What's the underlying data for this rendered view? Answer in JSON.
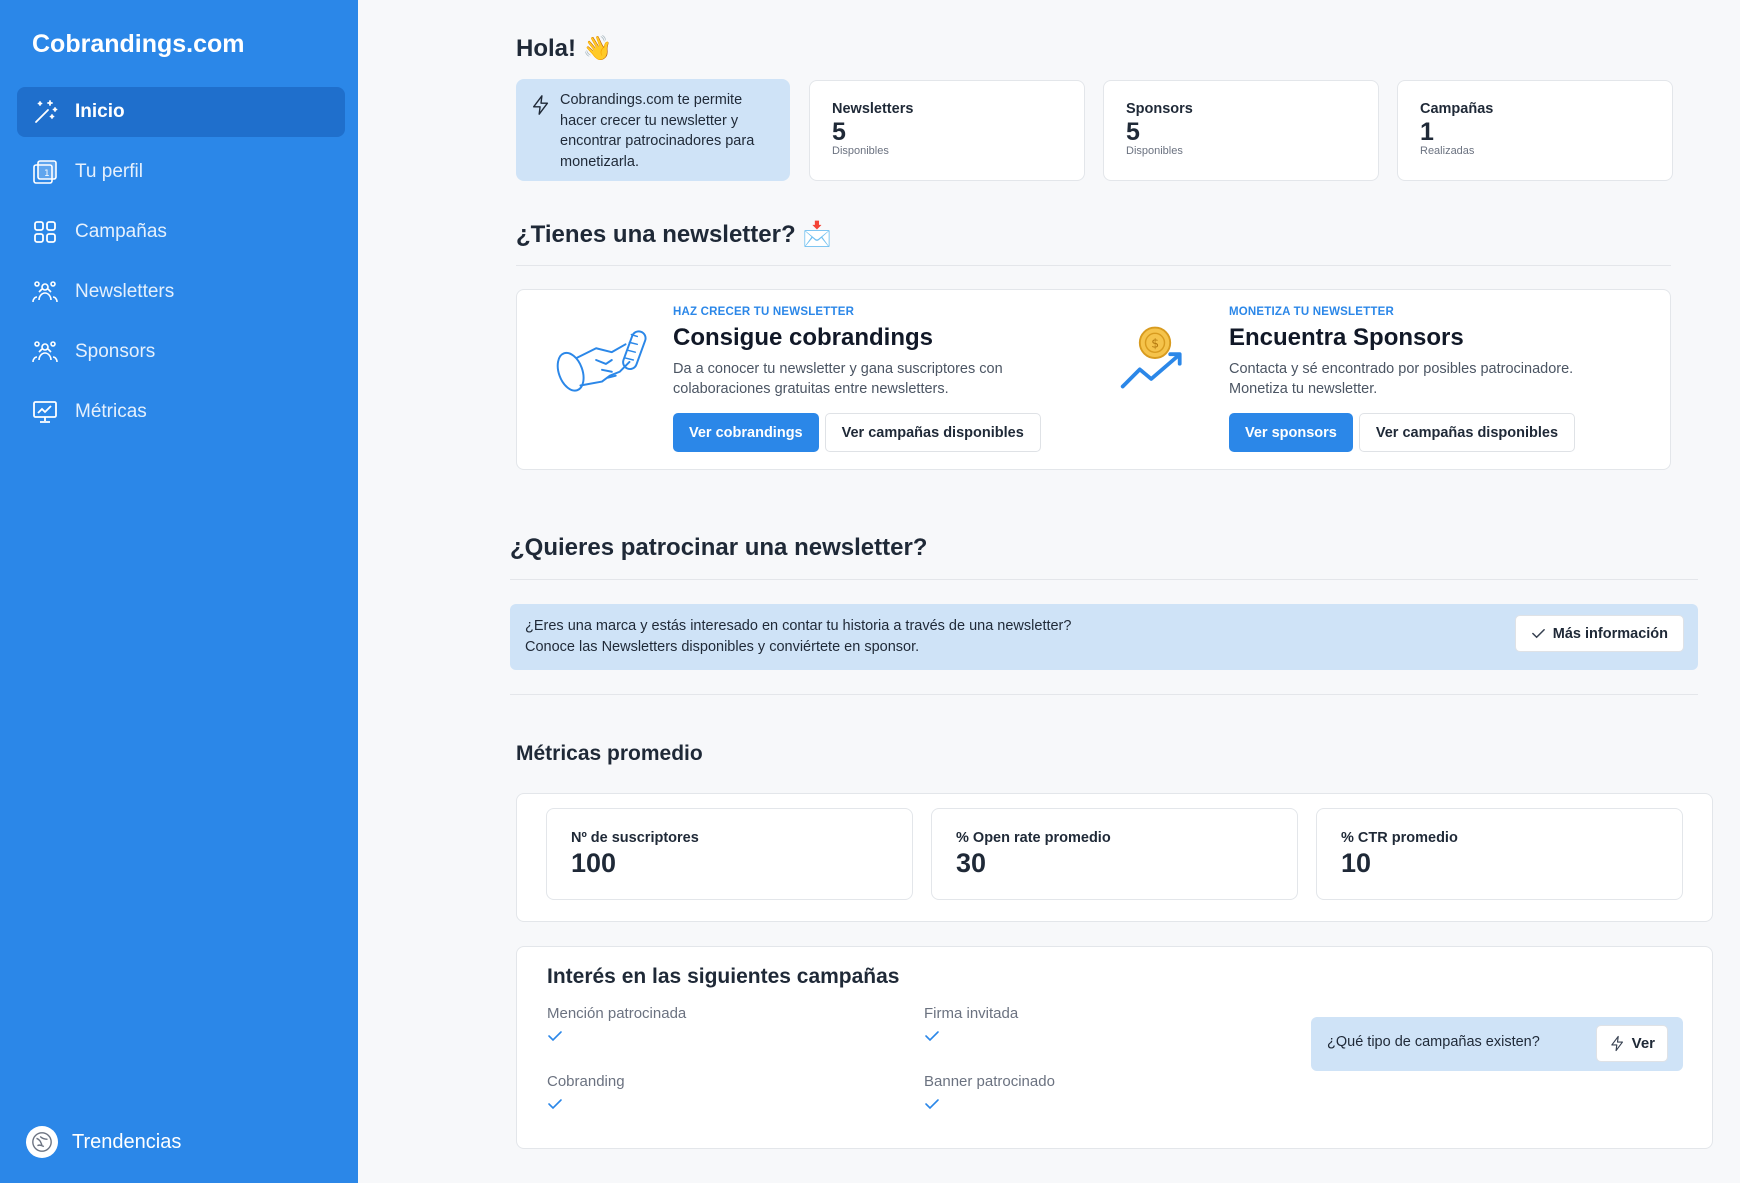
{
  "app": {
    "brand": "Cobrandings.com"
  },
  "sidebar": {
    "items": [
      {
        "label": "Inicio",
        "icon": "magic-wand-icon",
        "active": true
      },
      {
        "label": "Tu perfil",
        "icon": "profile-card-icon",
        "active": false
      },
      {
        "label": "Campañas",
        "icon": "grid-icon",
        "active": false
      },
      {
        "label": "Newsletters",
        "icon": "people-network-icon",
        "active": false
      },
      {
        "label": "Sponsors",
        "icon": "people-network-icon",
        "active": false
      },
      {
        "label": "Métricas",
        "icon": "monitor-chart-icon",
        "active": false
      }
    ],
    "footer": {
      "label": "Trendencias",
      "icon": "avatar-icon"
    }
  },
  "greeting": {
    "title": "Hola! 👋"
  },
  "intro": {
    "text": "Cobrandings.com te permite hacer crecer tu newsletter y encontrar patrocinadores para monetizarla."
  },
  "stats": [
    {
      "label": "Newsletters",
      "value": "5",
      "sub": "Disponibles"
    },
    {
      "label": "Sponsors",
      "value": "5",
      "sub": "Disponibles"
    },
    {
      "label": "Campañas",
      "value": "1",
      "sub": "Realizadas"
    }
  ],
  "newsletter_section": {
    "title": "¿Tienes una newsletter? 📩",
    "promos": [
      {
        "eyebrow": "HAZ CRECER TU NEWSLETTER",
        "title": "Consigue cobrandings",
        "desc1": "Da a conocer tu newsletter y gana suscriptores con",
        "desc2": "colaboraciones gratuitas entre newsletters.",
        "primary": "Ver cobrandings",
        "secondary": "Ver campañas disponibles"
      },
      {
        "eyebrow": "MONETIZA TU NEWSLETTER",
        "title": "Encuentra Sponsors",
        "desc1": "Contacta y sé encontrado por posibles patrocinadore.",
        "desc2": "Monetiza tu newsletter.",
        "primary": "Ver sponsors",
        "secondary": "Ver campañas disponibles"
      }
    ]
  },
  "sponsor_section": {
    "title": "¿Quieres patrocinar una newsletter?",
    "line1": "¿Eres una marca y estás interesado en contar tu historia a través de una newsletter?",
    "line2": "Conoce las Newsletters disponibles y conviértete en sponsor.",
    "button": "Más información"
  },
  "metrics": {
    "title": "Métricas promedio",
    "items": [
      {
        "label": "Nº de suscriptores",
        "value": "100"
      },
      {
        "label": "% Open rate promedio",
        "value": "30"
      },
      {
        "label": "% CTR promedio",
        "value": "10"
      }
    ]
  },
  "campaigns": {
    "title": "Interés en las siguientes campañas",
    "items": [
      {
        "label": "Mención patrocinada",
        "checked": true
      },
      {
        "label": "Firma invitada",
        "checked": true
      },
      {
        "label": "Cobranding",
        "checked": true
      },
      {
        "label": "Banner patrocinado",
        "checked": true
      }
    ],
    "question": "¿Qué tipo de campañas existen?",
    "button": "Ver"
  },
  "colors": {
    "primary": "#2b87e8",
    "light_blue": "#cfe3f7",
    "active_nav": "#1f6fcc"
  }
}
